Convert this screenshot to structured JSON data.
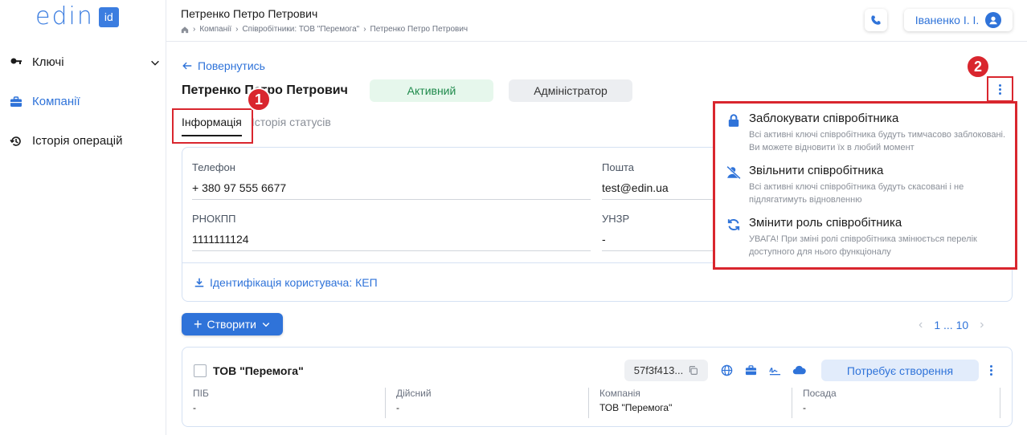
{
  "sidebar": {
    "logo_text": "edin",
    "logo_badge": "id",
    "items": [
      {
        "label": "Ключі",
        "icon": "key-icon"
      },
      {
        "label": "Компанії",
        "icon": "briefcase-icon"
      },
      {
        "label": "Історія операцій",
        "icon": "history-icon"
      }
    ]
  },
  "header": {
    "title": "Петренко Петро Петрович",
    "breadcrumbs": [
      "Компанії",
      "Співробітники: ТОВ \"Перемога\"",
      "Петренко Петро Петрович"
    ],
    "user_name": "Іваненко І. І."
  },
  "main": {
    "back_label": "Повернутись",
    "employee_name": "Петренко Петро Петрович",
    "status_badge": "Активний",
    "role_badge": "Адміністратор",
    "tabs": [
      "Інформація",
      "Історія статусів"
    ],
    "fields": {
      "phone_label": "Телефон",
      "phone_value": "+ 380 97 555 6677",
      "email_label": "Пошта",
      "email_value": "test@edin.ua",
      "rnokpp_label": "РНОКПП",
      "rnokpp_value": "1111111124",
      "unzr_label": "УНЗР",
      "unzr_value": "-"
    },
    "identification": "Ідентифікація користувача: КЕП",
    "create_button": "Створити",
    "pager_label": "1 ... 10",
    "company_row": {
      "name": "ТОВ \"Перемога\"",
      "code": "57f3f413...",
      "status": "Потребує створення",
      "columns": [
        {
          "label": "ПІБ",
          "value": "-"
        },
        {
          "label": "Дійсний",
          "value": "-"
        },
        {
          "label": "Компанія",
          "value": "ТОВ \"Перемога\""
        },
        {
          "label": "Посада",
          "value": "-"
        }
      ]
    }
  },
  "menu": {
    "items": [
      {
        "title": "Заблокувати співробітника",
        "desc": "Всі активні ключі співробітника будуть тимчасово заблоковані. Ви можете відновити їх в любий момент",
        "icon": "lock-icon"
      },
      {
        "title": "Звільнити співробітника",
        "desc": "Всі активні ключі співробітника будуть скасовані і не підлягатимуть відновленню",
        "icon": "remove-user-icon"
      },
      {
        "title": "Змінити роль співробітника",
        "desc": "УВАГА! При зміні ролі співробітника змінюється перелік доступного для нього функціоналу",
        "icon": "refresh-icon"
      }
    ]
  },
  "callouts": [
    "1",
    "2"
  ],
  "colors": {
    "accent": "#2f73d9",
    "annotation": "#d9262e",
    "active_green": "#1f8a4c"
  }
}
